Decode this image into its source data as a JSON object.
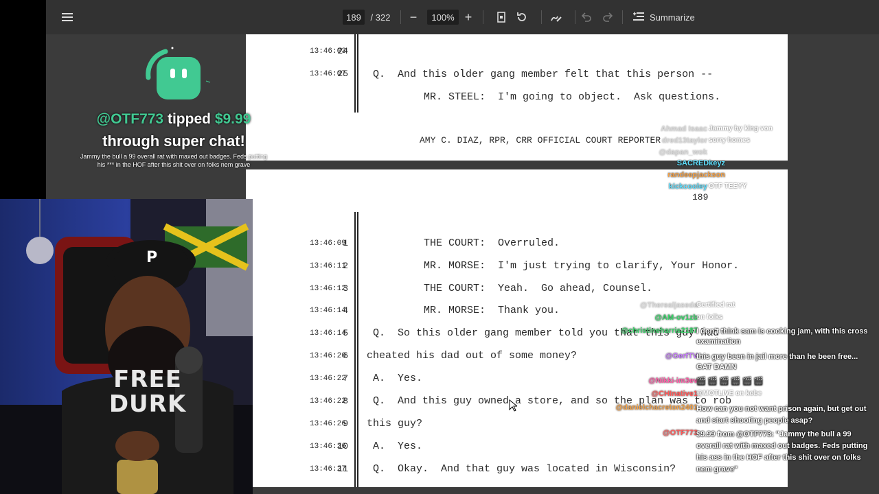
{
  "toolbar": {
    "page_current": "189",
    "page_total": "/ 322",
    "zoom": "100%",
    "summarize_label": "Summarize"
  },
  "page_top": {
    "lines": [
      {
        "num": "24",
        "time": "13:46:03",
        "text": "Q.  And this older gang member felt that this person --"
      },
      {
        "num": "25",
        "time": "13:46:07",
        "text": "MR. STEEL:  I'm going to object.  Ask questions."
      }
    ],
    "footer": "AMY C. DIAZ, RPR, CRR OFFICIAL COURT REPORTER"
  },
  "page_bottom": {
    "page_number": "189",
    "lines": [
      {
        "num": "1",
        "time": "13:46:09",
        "text": "THE COURT:  Overruled."
      },
      {
        "num": "2",
        "time": "13:46:11",
        "text": "MR. MORSE:  I'm just trying to clarify, Your Honor."
      },
      {
        "num": "3",
        "time": "13:46:12",
        "text": "THE COURT:  Yeah.  Go ahead, Counsel."
      },
      {
        "num": "4",
        "time": "13:46:14",
        "text": "MR. MORSE:  Thank you."
      },
      {
        "num": "5",
        "time": "13:46:14",
        "text": "Q.  So this older gang member told you that this guy had"
      },
      {
        "num": "6",
        "time": "13:46:20",
        "text": "cheated his dad out of some money?"
      },
      {
        "num": "7",
        "time": "13:46:22",
        "text": "A.  Yes."
      },
      {
        "num": "8",
        "time": "13:46:22",
        "text": "Q.  And this guy owned a store, and so the plan was to rob"
      },
      {
        "num": "9",
        "time": "13:46:26",
        "text": "this guy?"
      },
      {
        "num": "10",
        "time": "13:46:26",
        "text": "A.  Yes."
      },
      {
        "num": "11",
        "time": "13:46:27",
        "text": "Q.  Okay.  And that guy was located in Wisconsin?"
      }
    ]
  },
  "tip": {
    "user": "@OTF773",
    "tipped": "tipped",
    "amount": "$9.99",
    "through": "through super chat!",
    "message": "Jammy the bull a 99 overall rat with maxed out badges. Feds putting his *** in the HOF after this shit over on folks nem grave"
  },
  "shirt_text": "FREE DURK",
  "cap_letter": "P",
  "chat_top": [
    {
      "user": "Ahmad Isaac",
      "msg": "Jammy by king von",
      "color": "#aaaaaa"
    },
    {
      "user": "dred13taylor",
      "msg": "sorry homes",
      "color": "#aaaaaa"
    },
    {
      "user": "@dapan_wok",
      "msg": "",
      "color": "#aaaaaa"
    },
    {
      "user": "SACREDkeyz",
      "msg": "",
      "color": "#5ee0ff"
    },
    {
      "user": "randeepjackson",
      "msg": "",
      "color": "#f3a24a"
    },
    {
      "user": "kickcooley",
      "msg": "OTF TEEYY",
      "color": "#5ee0ff"
    }
  ],
  "chat_bottom": [
    {
      "user": "@Therealjaseda",
      "msg": "Certified rat",
      "color": "#aaaaaa"
    },
    {
      "user": "@AM-ov1zb",
      "msg": "on folks",
      "color": "#3bd66b"
    },
    {
      "user": "@christineharris2187",
      "msg": "I don't think sam is cooking jam, with this cross examination",
      "color": "#3bd66b"
    },
    {
      "user": "@GerfTV",
      "msg": "this guy been in jail more than he been free... GAT DAMN",
      "color": "#c77dff"
    },
    {
      "user": "@Nikki-im3ev",
      "msg": "🎬 🎬 🎬 🎬 🎬 🎬",
      "color": "#ff5fa8"
    },
    {
      "user": "@CHInative1",
      "msg": "@MOTLIVE on kobe",
      "color": "#ff5a5a"
    },
    {
      "user": "@danielchacreton2401",
      "msg": "How can you not want prison again, but get out and start shooting people asap?",
      "color": "#f3a24a"
    },
    {
      "user": "@OTF773",
      "msg": "$9.99 from @OTF773: \"Jammy the bull a 99 overall rat with maxed out badges. Feds putting his ass in the HOF after this shit over on folks nem grave\"",
      "color": "#ff5a5a"
    }
  ],
  "colors": {
    "accent": "#41c992",
    "toolbar": "#323232",
    "viewer_bg": "#3b3b3b"
  }
}
